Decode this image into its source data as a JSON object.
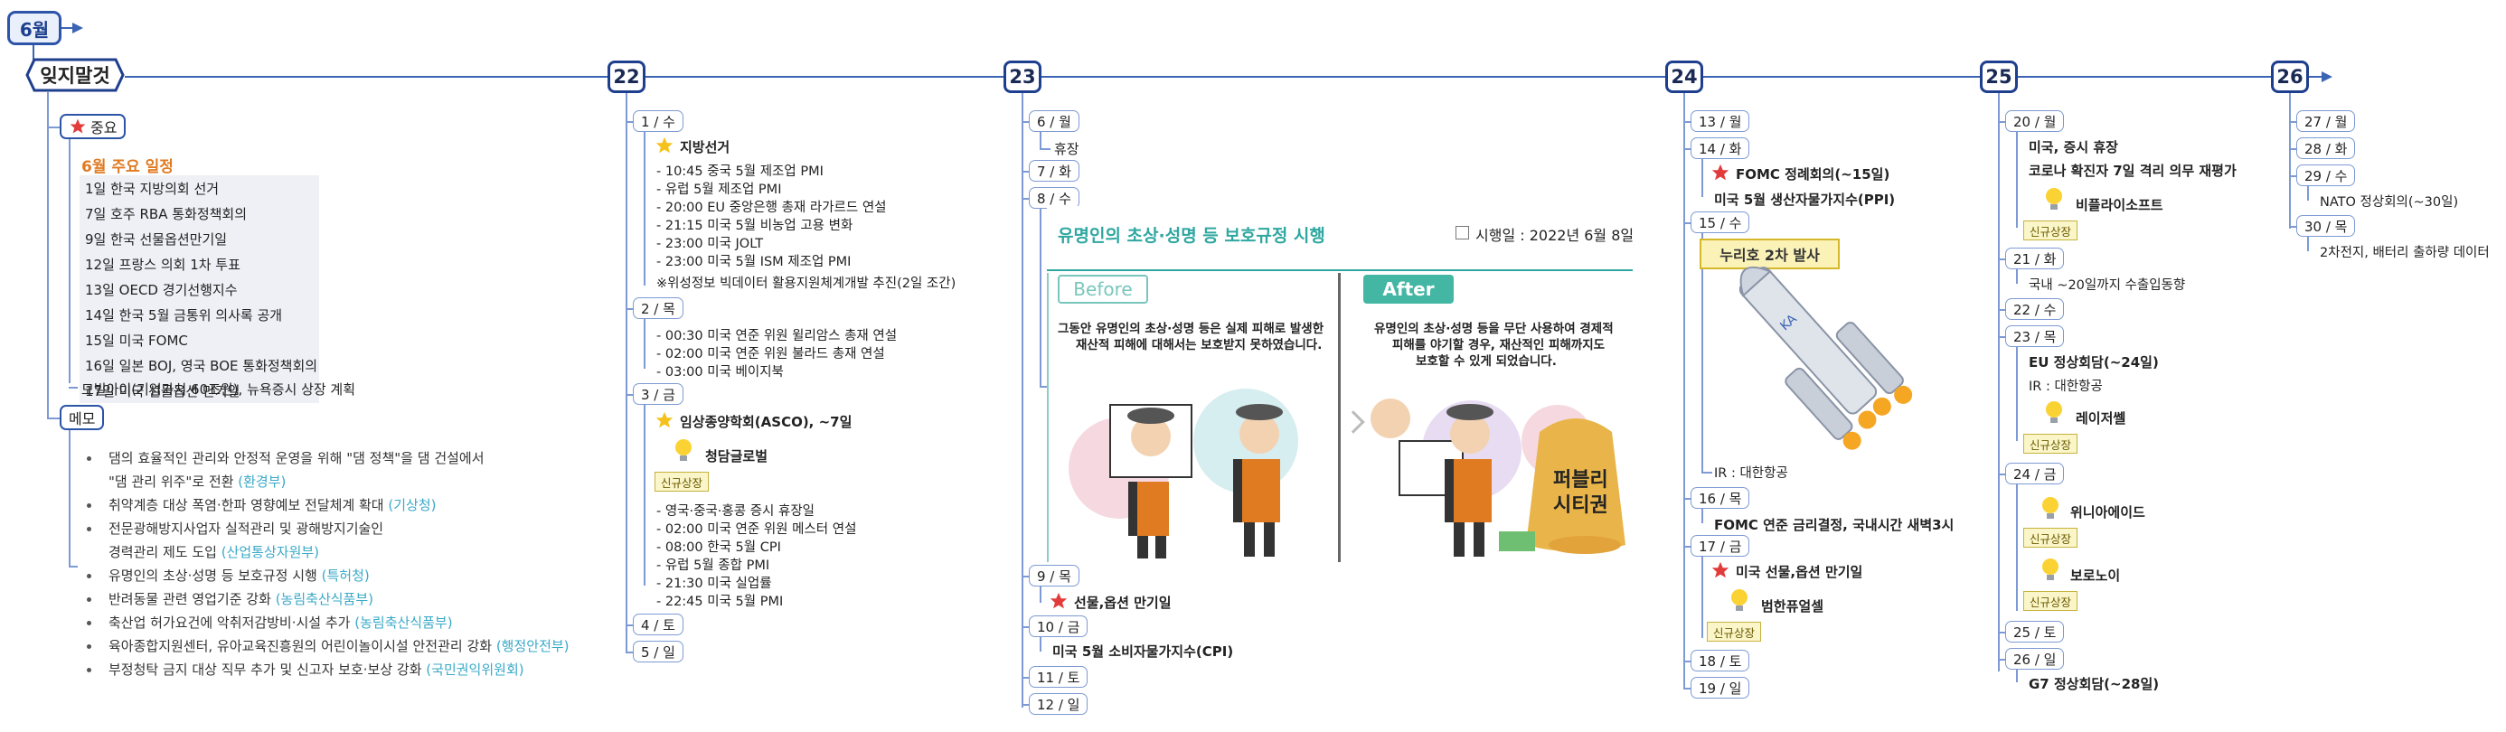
{
  "month": "6월",
  "forget": "잊지말것",
  "days": {
    "d22": "22",
    "d23": "23",
    "d24": "24",
    "d25": "25",
    "d26": "26"
  },
  "important": {
    "label": "중요",
    "title": "6월 주요 일정",
    "items": [
      "1일   한국 지방의회 선거",
      "7일   호주 RBA 통화정책회의",
      "9일   한국 선물옵션만기일",
      "12일 프랑스 의회 1차 투표",
      "13일 OECD 경기선행지수",
      "14일 한국 5월 금통위 의사록 공개",
      "15일 미국 FOMC",
      "16일 일본 BOJ, 영국 BOE 통화정책회의",
      "17일 미국 선물옵션 만기일"
    ],
    "extra": "모빌아이(기업가치 60조원), 뉴욕증시 상장 계획"
  },
  "memo": {
    "label": "메모",
    "items": [
      {
        "text": "댐의 효율적인 관리와 안정적 운영을 위해 \"댐 정책\"을 댐 건설에서",
        "src": ""
      },
      {
        "text": "\"댐 관리 위주\"로 전환 ",
        "src": "(환경부)"
      },
      {
        "text": "취약계층 대상 폭염·한파 영향예보 전달체계 확대 ",
        "src": "(기상청)"
      },
      {
        "text": "전문광해방지사업자 실적관리 및 광해방지기술인",
        "src": ""
      },
      {
        "text": "경력관리 제도 도입 ",
        "src": "(산업통상자원부)"
      },
      {
        "text": "유명인의 초상·성명 등 보호규정 시행 ",
        "src": "(특허청)"
      },
      {
        "text": "반려동물 관련 영업기준 강화 ",
        "src": "(농림축산식품부)"
      },
      {
        "text": "축산업 허가요건에 악취저감방비·시설 추가 ",
        "src": "(농림축산식품부)"
      },
      {
        "text": "육아종합지원센터, 유아교육진흥원의 어린이놀이시설 안전관리 강화 ",
        "src": "(행정안전부)"
      },
      {
        "text": "부정청탁 금지 대상 직무 추가 및 신고자 보호·보상 강화 ",
        "src": "(국민권익위원회)"
      }
    ]
  },
  "col22": {
    "wed": "1 / 수",
    "local": "지방선거",
    "wedItems": [
      "- 10:45 중국 5월 제조업 PMI",
      "- 유럽 5월 제조업 PMI",
      "- 20:00 EU 중앙은행 총재 라가르드 연설",
      "- 21:15 미국 5월 비농업 고용 변화",
      "- 23:00 미국 JOLT",
      "- 23:00 미국 5월 ISM 제조업 PMI",
      "※위성정보 빅데이터 활용지원체계개발 추진(2일 조간)"
    ],
    "thu": "2 / 목",
    "thuItems": [
      "- 00:30 미국 연준 위원 윌리암스 총재 연설",
      "- 02:00 미국 연준 위원 불라드 총재 연설",
      "- 03:00 미국 베이지북"
    ],
    "fri": "3 / 금",
    "asco": "임상종양학회(ASCO), ~7일",
    "chungdam": "청담글로벌",
    "newListing": "신규상장",
    "friItems": [
      "- 영국·중국·홍콩 증시 휴장일",
      "- 02:00 미국 연준 위원 메스터 연설",
      "- 08:00 한국 5월 CPI",
      "- 유럽 5월 종합 PMI",
      "- 21:30 미국 실업률",
      "- 22:45 미국 5월 PMI"
    ],
    "sat": "4 / 토",
    "sun": "5 / 일"
  },
  "col23": {
    "mon": "6 / 월",
    "holiday": "휴장",
    "tue": "7 / 화",
    "wed": "8 / 수",
    "infoTitle": "유명인의 초상·성명 등 보호규정 시행",
    "infoDate": "시행일 : 2022년 6월 8일",
    "before": "Before",
    "after": "After",
    "beforeText1": "그동안 유명인의 초상·성명 등은 실제 피해로 발생한",
    "beforeText2": "재산적 피해에 대해서는 보호받지 못하였습니다.",
    "afterText1": "유명인의 초상·성명 등을 무단 사용하여 경제적",
    "afterText2": "피해를 야기할 경우, 재산적인 피해까지도",
    "afterText3": "보호할 수 있게 되었습니다.",
    "publicity1": "퍼블리",
    "publicity2": "시티권",
    "thu": "9 / 목",
    "futures": "선물,옵션 만기일",
    "fri": "10 / 금",
    "cpi": "미국 5월 소비자물가지수(CPI)",
    "sat": "11 / 토",
    "sun": "12 / 일"
  },
  "col24": {
    "mon": "13 / 월",
    "tue": "14 / 화",
    "fomc": "FOMC 정례회의(~15일)",
    "ppi": "미국 5월 생산자물가지수(PPI)",
    "wed": "15 / 수",
    "nuri": "누리호 2차 발사",
    "ir": "IR : 대한항공",
    "thu": "16 / 목",
    "fomcRate": "FOMC 연준 금리결정, 국내시간 새벽3시",
    "fri": "17 / 금",
    "usFutures": "미국 선물,옵션 만기일",
    "bumhan": "범한퓨얼셀",
    "newListing": "신규상장",
    "sat": "18 / 토",
    "sun": "19 / 일"
  },
  "col25": {
    "mon": "20 / 월",
    "usHoliday": "미국, 증시 휴장",
    "covid": "코로나 확진자 7일 격리 의무 재평가",
    "vira": "비플라이소프트",
    "newListing": "신규상장",
    "tue": "21 / 화",
    "export": "국내 ~20일까지 수출입동향",
    "wed": "22 / 수",
    "thu": "23 / 목",
    "eu": "EU 정상회담(~24일)",
    "ir": "IR : 대한항공",
    "laser": "레이저쎌",
    "fri": "24 / 금",
    "uni": "위니아에이드",
    "boro": "보로노이",
    "sat": "25 / 토",
    "sun": "26 / 일",
    "g7": "G7 정상회담(~28일)"
  },
  "col26": {
    "mon": "27 / 월",
    "tue": "28 / 화",
    "wed": "29 / 수",
    "nato": "NATO 정상회의(~30일)",
    "thu": "30 / 목",
    "battery": "2차전지, 배터리 출하량 데이터"
  }
}
